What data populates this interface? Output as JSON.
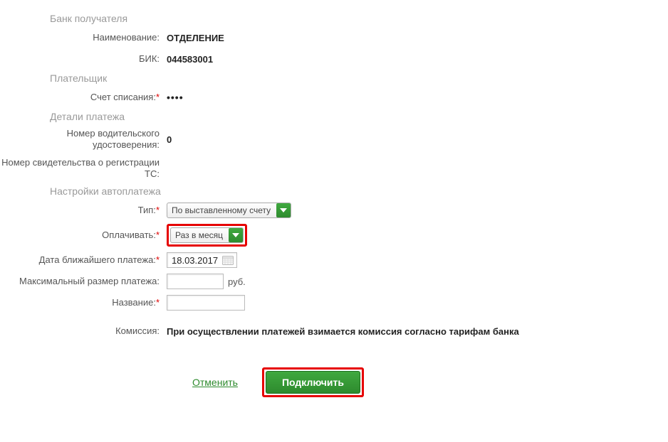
{
  "sections": {
    "bank": "Банк получателя",
    "payer": "Плательщик",
    "details": "Детали платежа",
    "autopay": "Настройки автоплатежа"
  },
  "bank": {
    "name_label": "Наименование:",
    "name_value": "ОТДЕЛЕНИЕ",
    "bik_label": "БИК:",
    "bik_value": "044583001"
  },
  "payer": {
    "account_label": "Счет списания:",
    "account_value": "••••"
  },
  "details": {
    "license_label": "Номер водительского удостоверения:",
    "license_value": "0",
    "reg_label": "Номер свидетельства о регистрации ТС:",
    "reg_value": ""
  },
  "autopay": {
    "type_label": "Тип:",
    "type_value": "По выставленному счету",
    "pay_label": "Оплачивать:",
    "pay_value": "Раз в месяц",
    "date_label": "Дата ближайшего платежа:",
    "date_value": "18.03.2017",
    "max_label": "Максимальный размер платежа:",
    "max_value": "",
    "max_suffix": "руб.",
    "name_label": "Название:",
    "name_value": "",
    "commission_label": "Комиссия:",
    "commission_value": "При осуществлении платежей взимается комиссия согласно тарифам банка"
  },
  "actions": {
    "cancel": "Отменить",
    "submit": "Подключить"
  }
}
